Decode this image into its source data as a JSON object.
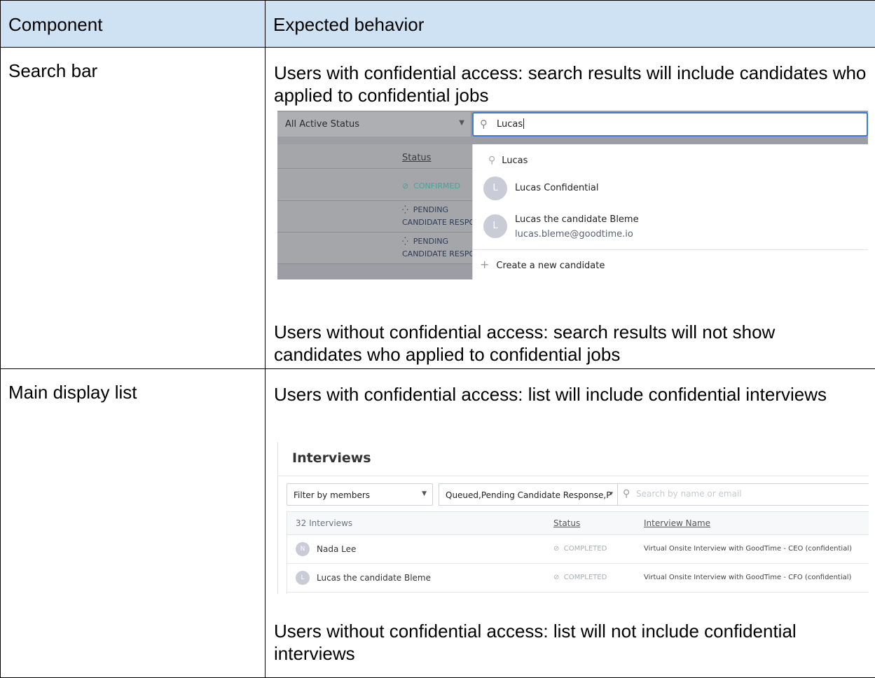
{
  "table": {
    "headers": [
      "Component",
      "Expected behavior"
    ],
    "rows": [
      {
        "component": "Search bar",
        "with_access": "Users with confidential access: search results will include candidates who applied to confidential jobs",
        "without_access": "Users without confidential access: search results will not show candidates who applied to confidential jobs"
      },
      {
        "component": "Main display list",
        "with_access": "Users with confidential access: list will include confidential interviews",
        "without_access": "Users without confidential access: list will not include confidential interviews"
      }
    ]
  },
  "search_shot": {
    "status_filter": "All Active Status",
    "search_value": "Lucas",
    "status_header": "Status",
    "statuses": [
      {
        "icon": "check-circle-icon",
        "lines": [
          "CONFIRMED"
        ]
      },
      {
        "icon": "spinner-icon",
        "lines": [
          "PENDING",
          "CANDIDATE RESPO"
        ]
      },
      {
        "icon": "spinner-icon",
        "lines": [
          "PENDING",
          "CANDIDATE RESPO"
        ]
      }
    ],
    "dropdown": {
      "query": "Lucas",
      "results": [
        {
          "initial": "L",
          "name": "Lucas Confidential",
          "email": ""
        },
        {
          "initial": "L",
          "name": "Lucas the candidate Bleme",
          "email": "lucas.bleme@goodtime.io"
        }
      ],
      "create_label": "Create a new candidate"
    },
    "colors": {
      "focus_border": "#3a7bd5",
      "confirmed": "#3fa89b",
      "pending": "#2e3b55"
    }
  },
  "interviews_shot": {
    "title": "Interviews",
    "filter_members": "Filter by members",
    "status_filter": "Queued,Pending Candidate Response,P",
    "search_placeholder": "Search by name or email",
    "columns": [
      "32 Interviews",
      "Status",
      "Interview Name"
    ],
    "rows": [
      {
        "initial": "N",
        "name": "Nada Lee",
        "status": "COMPLETED",
        "interview": "Virtual Onsite Interview with GoodTime - CEO (confidential)"
      },
      {
        "initial": "L",
        "name": "Lucas the candidate Bleme",
        "status": "COMPLETED",
        "interview": "Virtual Onsite Interview with GoodTime - CFO (confidential)"
      }
    ]
  }
}
